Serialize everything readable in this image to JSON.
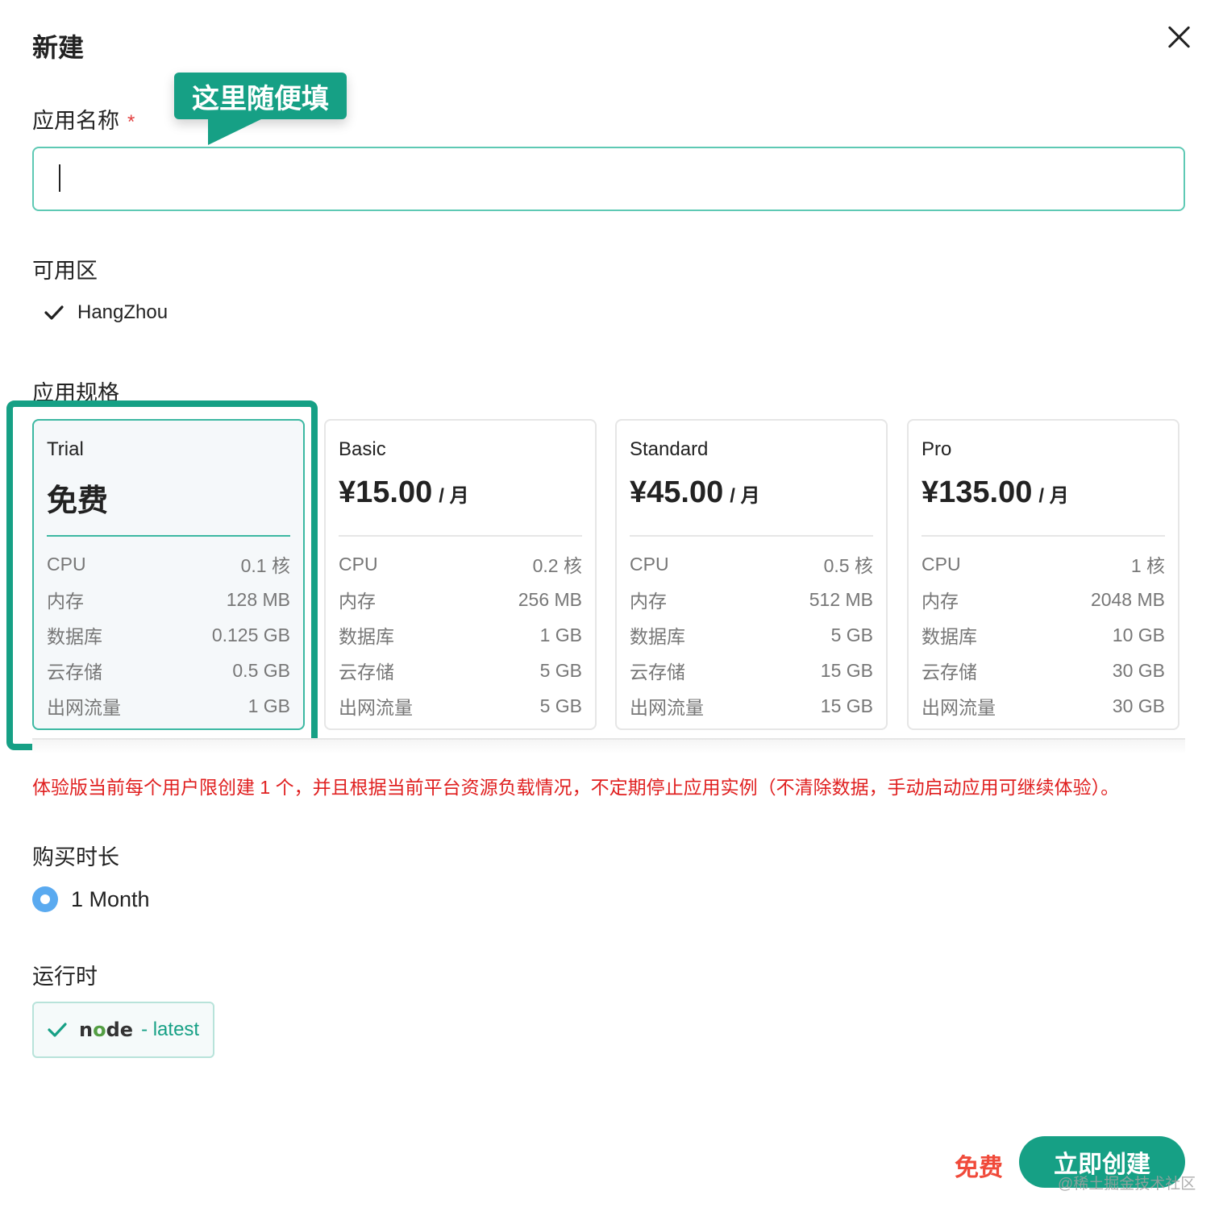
{
  "dialog": {
    "title": "新建",
    "close_label": "×"
  },
  "app_name": {
    "label": "应用名称",
    "required_mark": "*",
    "tooltip": "这里随便填",
    "value": "",
    "placeholder": ""
  },
  "zone": {
    "label": "可用区",
    "selected": "HangZhou"
  },
  "specs": {
    "label": "应用规格",
    "selected_index": 0,
    "plans": [
      {
        "name": "Trial",
        "price": "免费",
        "unit": "",
        "rows": [
          {
            "key": "CPU",
            "value": "0.1 核"
          },
          {
            "key": "内存",
            "value": "128 MB"
          },
          {
            "key": "数据库",
            "value": "0.125 GB"
          },
          {
            "key": "云存储",
            "value": "0.5 GB"
          },
          {
            "key": "出网流量",
            "value": "1 GB"
          }
        ]
      },
      {
        "name": "Basic",
        "price": "¥15.00",
        "unit": "/ 月",
        "rows": [
          {
            "key": "CPU",
            "value": "0.2 核"
          },
          {
            "key": "内存",
            "value": "256 MB"
          },
          {
            "key": "数据库",
            "value": "1 GB"
          },
          {
            "key": "云存储",
            "value": "5 GB"
          },
          {
            "key": "出网流量",
            "value": "5 GB"
          }
        ]
      },
      {
        "name": "Standard",
        "price": "¥45.00",
        "unit": "/ 月",
        "rows": [
          {
            "key": "CPU",
            "value": "0.5 核"
          },
          {
            "key": "内存",
            "value": "512 MB"
          },
          {
            "key": "数据库",
            "value": "5 GB"
          },
          {
            "key": "云存储",
            "value": "15 GB"
          },
          {
            "key": "出网流量",
            "value": "15 GB"
          }
        ]
      },
      {
        "name": "Pro",
        "price": "¥135.00",
        "unit": "/ 月",
        "rows": [
          {
            "key": "CPU",
            "value": "1 核"
          },
          {
            "key": "内存",
            "value": "2048 MB"
          },
          {
            "key": "数据库",
            "value": "10 GB"
          },
          {
            "key": "云存储",
            "value": "30 GB"
          },
          {
            "key": "出网流量",
            "value": "30 GB"
          }
        ]
      }
    ],
    "notice": "体验版当前每个用户限创建 1 个，并且根据当前平台资源负载情况，不定期停止应用实例（不清除数据，手动启动应用可继续体验）。"
  },
  "duration": {
    "label": "购买时长",
    "option": "1 Month"
  },
  "runtime": {
    "label": "运行时",
    "logo_parts": [
      "n",
      "o",
      "de"
    ],
    "tag": "- latest"
  },
  "footer": {
    "price": "免费",
    "create_label": "立即创建",
    "watermark": "@稀土掘金技术社区"
  },
  "colors": {
    "accent": "#16a085",
    "danger": "#e02020",
    "radio": "#5aaaf0",
    "price": "#f04a3a"
  }
}
